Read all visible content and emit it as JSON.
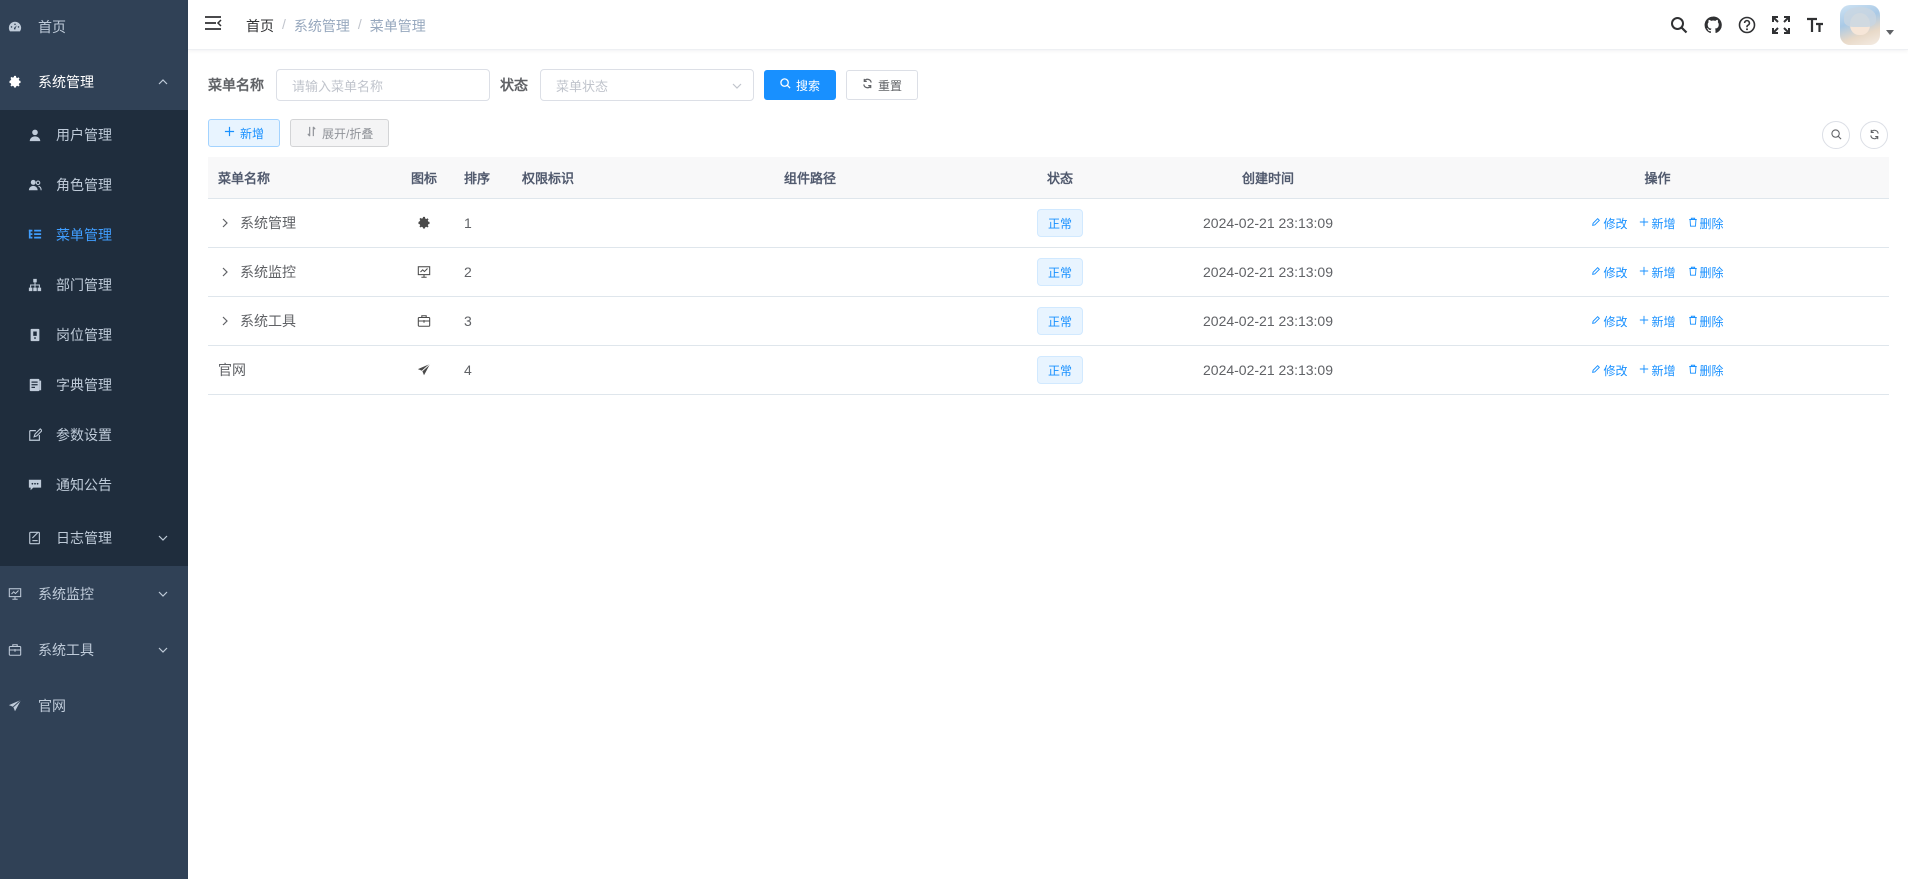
{
  "sidebar": {
    "home": "首页",
    "system": "系统管理",
    "sub": [
      {
        "label": "用户管理",
        "icon": "user-icon"
      },
      {
        "label": "角色管理",
        "icon": "peoples-icon"
      },
      {
        "label": "菜单管理",
        "icon": "tree-table-icon"
      },
      {
        "label": "部门管理",
        "icon": "tree-icon"
      },
      {
        "label": "岗位管理",
        "icon": "post-icon"
      },
      {
        "label": "字典管理",
        "icon": "dict-icon"
      },
      {
        "label": "参数设置",
        "icon": "edit-icon"
      },
      {
        "label": "通知公告",
        "icon": "message-icon"
      },
      {
        "label": "日志管理",
        "icon": "log-icon"
      }
    ],
    "monitor": "系统监控",
    "tool": "系统工具",
    "website": "官网"
  },
  "navbar": {
    "breadcrumb": [
      "首页",
      "系统管理",
      "菜单管理"
    ]
  },
  "search": {
    "name_label": "菜单名称",
    "name_placeholder": "请输入菜单名称",
    "status_label": "状态",
    "status_placeholder": "菜单状态",
    "search_btn": "搜索",
    "reset_btn": "重置"
  },
  "toolbar": {
    "add": "新增",
    "expand": "展开/折叠"
  },
  "table": {
    "headers": {
      "name": "菜单名称",
      "icon": "图标",
      "sort": "排序",
      "perms": "权限标识",
      "component": "组件路径",
      "status": "状态",
      "created": "创建时间",
      "ops": "操作"
    },
    "rows": [
      {
        "name": "系统管理",
        "icon": "system-icon",
        "sort": "1",
        "status": "正常",
        "created": "2024-02-21 23:13:09"
      },
      {
        "name": "系统监控",
        "icon": "monitor-icon",
        "sort": "2",
        "status": "正常",
        "created": "2024-02-21 23:13:09"
      },
      {
        "name": "系统工具",
        "icon": "tool-icon",
        "sort": "3",
        "status": "正常",
        "created": "2024-02-21 23:13:09"
      },
      {
        "name": "官网",
        "icon": "guide-icon",
        "sort": "4",
        "status": "正常",
        "created": "2024-02-21 23:13:09"
      }
    ],
    "ops": {
      "edit": "修改",
      "add": "新增",
      "delete": "删除"
    }
  },
  "colors": {
    "sidebar_bg": "#304156",
    "submenu_bg": "#1f2d3d",
    "primary": "#1890ff"
  }
}
